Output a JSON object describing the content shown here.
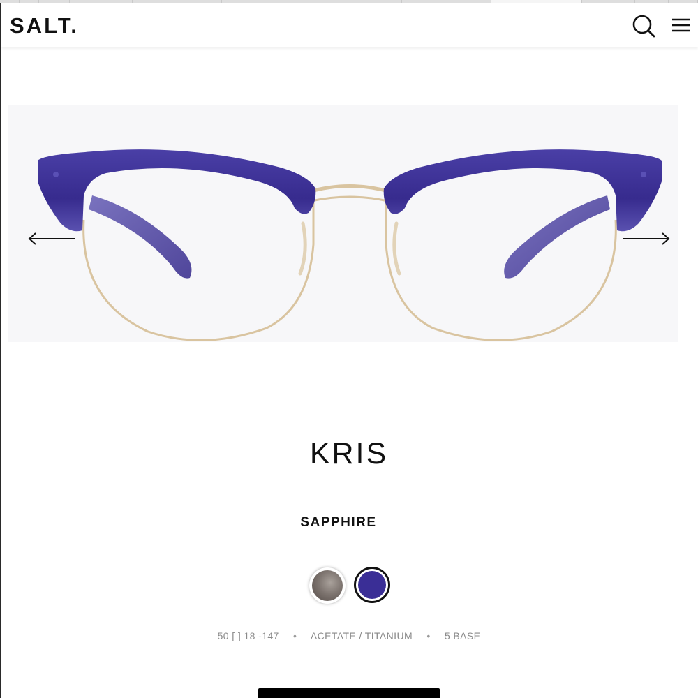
{
  "brand": {
    "logo": "SALT."
  },
  "header": {
    "search_icon": "search-icon",
    "menu_icon": "hamburger-menu-icon"
  },
  "gallery": {
    "image": "eyeglasses-product-image",
    "prev_icon": "arrow-left-icon",
    "next_icon": "arrow-right-icon"
  },
  "product": {
    "name": "KRIS",
    "color_name": "SAPPHIRE",
    "swatches": [
      {
        "color": "#6f6661",
        "selected": false
      },
      {
        "color": "#3a2e96",
        "selected": true
      }
    ],
    "specs": {
      "size": "50 [ ] 18 -147",
      "material": "ACETATE / TITANIUM",
      "base": "5 BASE",
      "separator": "•"
    }
  },
  "colors": {
    "frame_acetate": "#3a2e96",
    "frame_metal": "#d9c4a0",
    "text": "#111111",
    "muted": "#8a8a8a"
  }
}
